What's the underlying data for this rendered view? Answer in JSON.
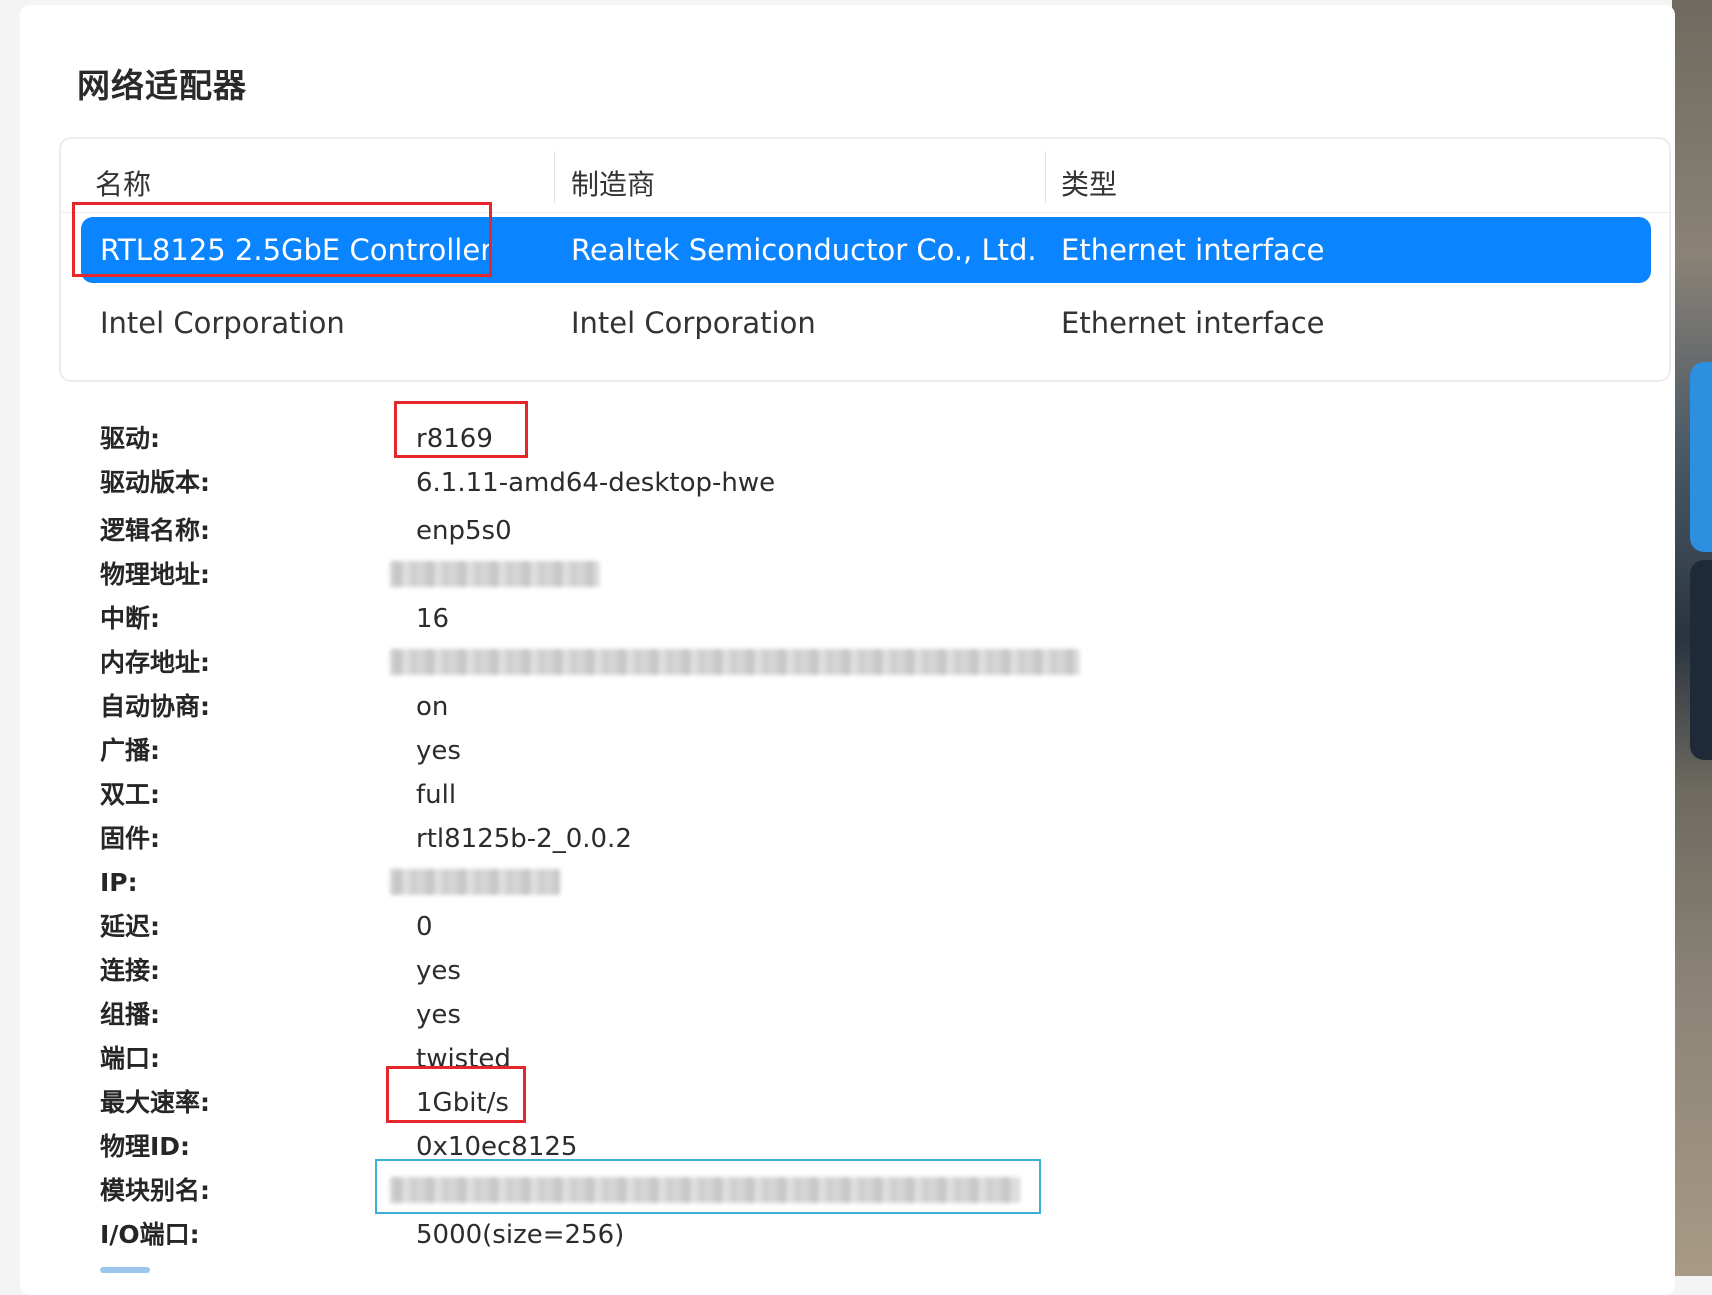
{
  "page": {
    "title": "网络适配器"
  },
  "table": {
    "columns": [
      "名称",
      "制造商",
      "类型"
    ],
    "rows": [
      {
        "name": "RTL8125 2.5GbE Controller",
        "vendor": "Realtek Semiconductor Co., Ltd.",
        "type": "Ethernet interface",
        "selected": true
      },
      {
        "name": "Intel Corporation",
        "vendor": "Intel Corporation",
        "type": "Ethernet interface",
        "selected": false
      }
    ]
  },
  "details": [
    {
      "label": "驱动:",
      "value": "r8169"
    },
    {
      "label": "驱动版本:",
      "value": "6.1.11-amd64-desktop-hwe"
    },
    {
      "label": "逻辑名称:",
      "value": "enp5s0"
    },
    {
      "label": "物理地址:",
      "value": "",
      "redacted": true
    },
    {
      "label": "中断:",
      "value": "16"
    },
    {
      "label": "内存地址:",
      "value": "",
      "redacted": true
    },
    {
      "label": "自动协商:",
      "value": "on"
    },
    {
      "label": "广播:",
      "value": "yes"
    },
    {
      "label": "双工:",
      "value": "full"
    },
    {
      "label": "固件:",
      "value": "rtl8125b-2_0.0.2"
    },
    {
      "label": "IP:",
      "value": "",
      "redacted": true
    },
    {
      "label": "延迟:",
      "value": "0"
    },
    {
      "label": "连接:",
      "value": "yes"
    },
    {
      "label": "组播:",
      "value": "yes"
    },
    {
      "label": "端口:",
      "value": "twisted"
    },
    {
      "label": "最大速率:",
      "value": "1Gbit/s"
    },
    {
      "label": "物理ID:",
      "value": "0x10ec8125"
    },
    {
      "label": "模块别名:",
      "value": "",
      "redacted": true
    },
    {
      "label": "I/O端口:",
      "value": "5000(size=256)"
    }
  ],
  "colors": {
    "selection": "#0a84ff",
    "annotation_red": "#e5262b",
    "annotation_blue": "#39b0d8"
  }
}
